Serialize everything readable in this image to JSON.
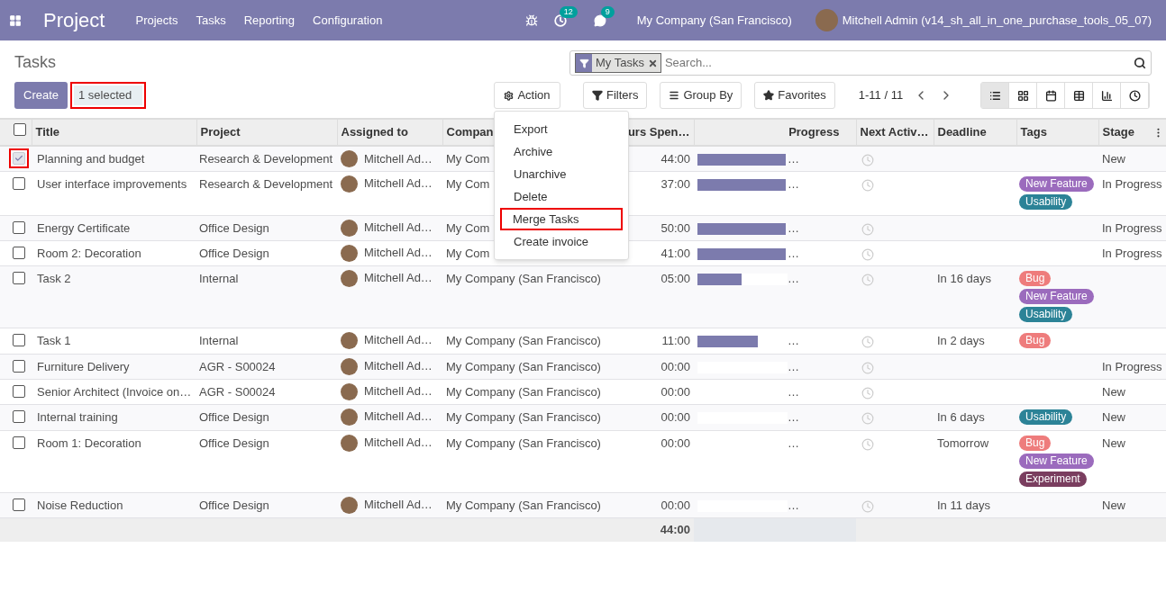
{
  "navbar": {
    "app_title": "Project",
    "menu": [
      "Projects",
      "Tasks",
      "Reporting",
      "Configuration"
    ],
    "activity_count": "12",
    "message_count": "9",
    "company": "My Company (San Francisco)",
    "user": "Mitchell Admin (v14_sh_all_in_one_purchase_tools_05_07)"
  },
  "breadcrumb": "Tasks",
  "create_button": "Create",
  "selection": {
    "label": "1 selected",
    "highlighted": true
  },
  "search": {
    "facets": [
      {
        "label": "My Tasks"
      }
    ],
    "placeholder": "Search..."
  },
  "action_button": "Action",
  "action_menu": [
    {
      "label": "Export",
      "highlighted": false
    },
    {
      "label": "Archive",
      "highlighted": false
    },
    {
      "label": "Unarchive",
      "highlighted": false
    },
    {
      "label": "Delete",
      "highlighted": false
    },
    {
      "label": "Merge Tasks",
      "highlighted": true
    },
    {
      "label": "Create invoice",
      "highlighted": false
    }
  ],
  "filter_buttons": [
    {
      "kind": "filter",
      "label": "Filters"
    },
    {
      "kind": "group",
      "label": "Group By"
    },
    {
      "kind": "favorites",
      "label": "Favorites"
    }
  ],
  "pager": "1-11 / 11",
  "views": [
    {
      "kind": "list",
      "selected": true
    },
    {
      "kind": "kanban",
      "selected": false
    },
    {
      "kind": "calendar",
      "selected": false
    },
    {
      "kind": "pivot",
      "selected": false
    },
    {
      "kind": "graph",
      "selected": false
    },
    {
      "kind": "activity",
      "selected": false
    }
  ],
  "table": {
    "select_all_checked": false,
    "columns": [
      "Title",
      "Project",
      "Assigned to",
      "Compan",
      "urs Spen…",
      "Progress",
      "Next Activ…",
      "Deadline",
      "Tags",
      "Stage"
    ],
    "rows": [
      {
        "checked": true,
        "highlighted": true,
        "title": "Planning and budget",
        "project": "Research & Development",
        "assignee": "Mitchell Ad…",
        "company": "My Com",
        "hours": "44:00",
        "level": 0.98,
        "more": "…",
        "tags": [],
        "stage": "New"
      },
      {
        "checked": false,
        "highlighted": false,
        "title": "User interface improvements",
        "project": "Research & Development",
        "assignee": "Mitchell Ad…",
        "company": "My Com",
        "hours": "37:00",
        "level": 0.98,
        "more": "…",
        "tags": [
          {
            "label": "New Feature",
            "color": "#9b6bbd"
          },
          {
            "label": "Usability",
            "color": "#2c8397"
          }
        ],
        "stage": "In Progress"
      },
      {
        "checked": false,
        "highlighted": false,
        "title": "Energy Certificate",
        "project": "Office Design",
        "assignee": "Mitchell Ad…",
        "company": "My Com",
        "hours": "50:00",
        "level": 0.98,
        "more": "…",
        "tags": [],
        "stage": "In Progress"
      },
      {
        "checked": false,
        "highlighted": false,
        "title": "Room 2: Decoration",
        "project": "Office Design",
        "assignee": "Mitchell Ad…",
        "company": "My Com",
        "hours": "41:00",
        "level": 0.98,
        "more": "…",
        "tags": [],
        "stage": "In Progress"
      },
      {
        "checked": false,
        "highlighted": false,
        "title": "Task 2",
        "project": "Internal",
        "assignee": "Mitchell Ad…",
        "company": "My Company (San Francisco)",
        "hours": "05:00",
        "level": 0.49,
        "more": "…",
        "deadline": "In 16 days",
        "tags": [
          {
            "label": "Bug",
            "color": "#ee7c7c"
          },
          {
            "label": "New Feature",
            "color": "#9b6bbd"
          },
          {
            "label": "Usability",
            "color": "#2c8397"
          }
        ]
      },
      {
        "checked": false,
        "highlighted": false,
        "title": "Task 1",
        "project": "Internal",
        "assignee": "Mitchell Ad…",
        "company": "My Company (San Francisco)",
        "hours": "11:00",
        "level": 0.67,
        "more": "…",
        "deadline": "In 2 days",
        "tags": [
          {
            "label": "Bug",
            "color": "#ee7c7c"
          }
        ]
      },
      {
        "checked": false,
        "highlighted": false,
        "title": "Furniture Delivery",
        "project": "AGR - S00024",
        "assignee": "Mitchell Ad…",
        "company": "My Company (San Francisco)",
        "hours": "00:00",
        "level": 0,
        "more": "…",
        "tags": [],
        "stage": "In Progress"
      },
      {
        "checked": false,
        "highlighted": false,
        "title": "Senior Architect (Invoice on…",
        "project": "AGR - S00024",
        "assignee": "Mitchell Ad…",
        "company": "My Company (San Francisco)",
        "hours": "00:00",
        "level": 0,
        "more": "…",
        "tags": [],
        "stage": "New"
      },
      {
        "checked": false,
        "highlighted": false,
        "title": "Internal training",
        "project": "Office Design",
        "assignee": "Mitchell Ad…",
        "company": "My Company (San Francisco)",
        "hours": "00:00",
        "level": 0,
        "more": "…",
        "deadline": "In 6 days",
        "tags": [
          {
            "label": "Usability",
            "color": "#2c8397"
          }
        ],
        "stage": "New"
      },
      {
        "checked": false,
        "highlighted": false,
        "title": "Room 1: Decoration",
        "project": "Office Design",
        "assignee": "Mitchell Ad…",
        "company": "My Company (San Francisco)",
        "hours": "00:00",
        "level": 0,
        "more": "…",
        "deadline": "Tomorrow",
        "tags": [
          {
            "label": "Bug",
            "color": "#ee7c7c"
          },
          {
            "label": "New Feature",
            "color": "#9b6bbd"
          },
          {
            "label": "Experiment",
            "color": "#7a3e5f"
          }
        ],
        "stage": "New"
      },
      {
        "checked": false,
        "highlighted": false,
        "title": "Noise Reduction",
        "project": "Office Design",
        "assignee": "Mitchell Ad…",
        "company": "My Company (San Francisco)",
        "hours": "00:00",
        "level": 0,
        "more": "…",
        "deadline": "In 11 days",
        "tags": [],
        "stage": "New"
      }
    ],
    "footer": {
      "hours": "44:00"
    }
  }
}
